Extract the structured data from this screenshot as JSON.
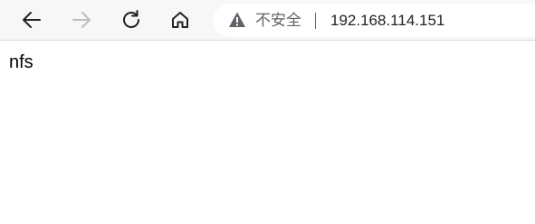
{
  "toolbar": {
    "back_icon": "arrow-left-icon",
    "forward_icon": "arrow-right-icon",
    "reload_icon": "reload-icon",
    "home_icon": "home-icon",
    "colors": {
      "toolbar_bg": "#f7f7f7",
      "icon_active": "#202124",
      "icon_disabled": "#bdbdbd",
      "warning": "#5f6368"
    }
  },
  "address_bar": {
    "security_icon": "warning-triangle-icon",
    "security_text": "不安全",
    "url": "192.168.114.151"
  },
  "page": {
    "body_text": "nfs"
  }
}
